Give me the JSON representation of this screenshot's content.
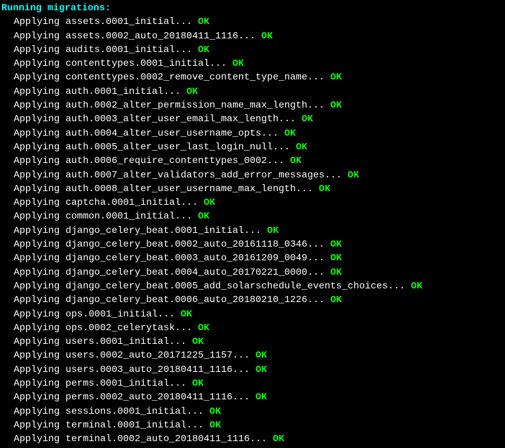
{
  "header": "Running migrations:",
  "applying_prefix": "Applying ",
  "dots": "... ",
  "ok_text": "OK",
  "migrations": [
    {
      "name": "assets.0001_initial"
    },
    {
      "name": "assets.0002_auto_20180411_1116"
    },
    {
      "name": "audits.0001_initial"
    },
    {
      "name": "contenttypes.0001_initial"
    },
    {
      "name": "contenttypes.0002_remove_content_type_name"
    },
    {
      "name": "auth.0001_initial"
    },
    {
      "name": "auth.0002_alter_permission_name_max_length"
    },
    {
      "name": "auth.0003_alter_user_email_max_length"
    },
    {
      "name": "auth.0004_alter_user_username_opts"
    },
    {
      "name": "auth.0005_alter_user_last_login_null"
    },
    {
      "name": "auth.0006_require_contenttypes_0002"
    },
    {
      "name": "auth.0007_alter_validators_add_error_messages"
    },
    {
      "name": "auth.0008_alter_user_username_max_length"
    },
    {
      "name": "captcha.0001_initial"
    },
    {
      "name": "common.0001_initial"
    },
    {
      "name": "django_celery_beat.0001_initial"
    },
    {
      "name": "django_celery_beat.0002_auto_20161118_0346"
    },
    {
      "name": "django_celery_beat.0003_auto_20161209_0049"
    },
    {
      "name": "django_celery_beat.0004_auto_20170221_0000"
    },
    {
      "name": "django_celery_beat.0005_add_solarschedule_events_choices"
    },
    {
      "name": "django_celery_beat.0006_auto_20180210_1226"
    },
    {
      "name": "ops.0001_initial"
    },
    {
      "name": "ops.0002_celerytask"
    },
    {
      "name": "users.0001_initial"
    },
    {
      "name": "users.0002_auto_20171225_1157"
    },
    {
      "name": "users.0003_auto_20180411_1116"
    },
    {
      "name": "perms.0001_initial"
    },
    {
      "name": "perms.0002_auto_20180411_1116"
    },
    {
      "name": "sessions.0001_initial"
    },
    {
      "name": "terminal.0001_initial"
    },
    {
      "name": "terminal.0002_auto_20180411_1116"
    }
  ]
}
